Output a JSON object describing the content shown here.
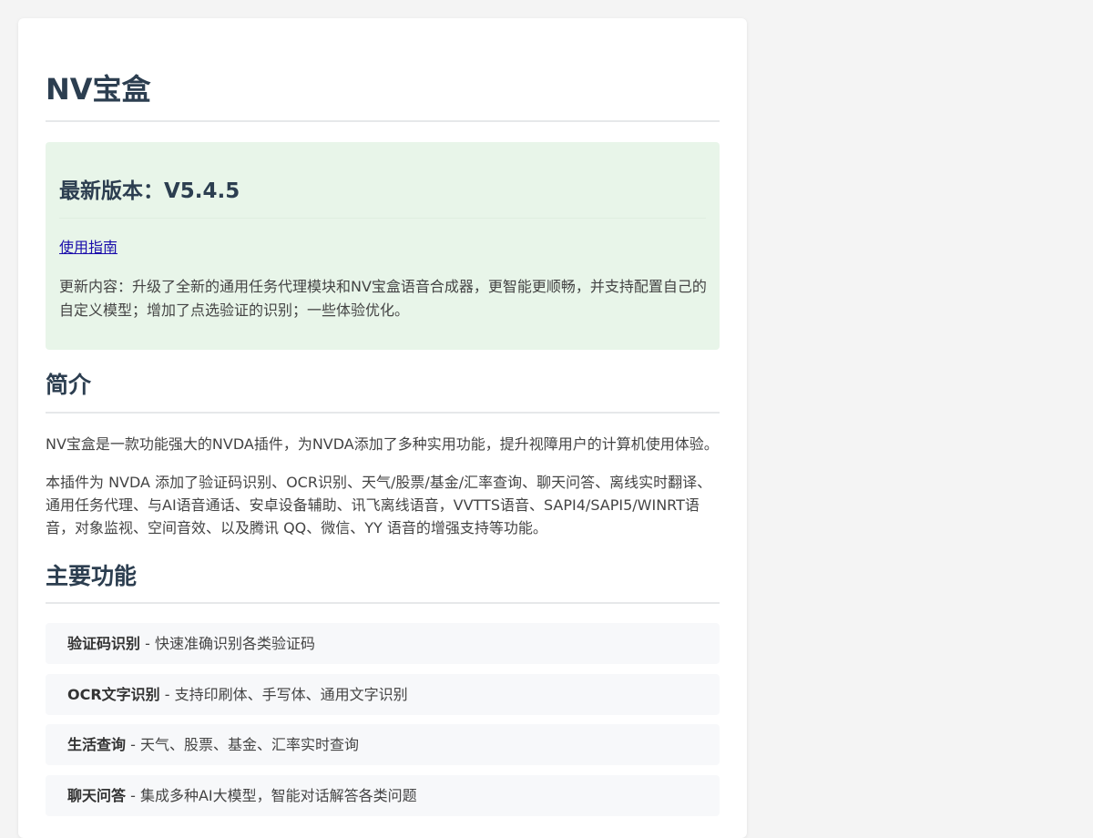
{
  "page_title": "NV宝盒",
  "version": {
    "title": "最新版本：V5.4.5",
    "guide_link": "使用指南",
    "update_notes": "更新内容：升级了全新的通用任务代理模块和NV宝盒语音合成器，更智能更顺畅，并支持配置自己的自定义模型；增加了点选验证的识别；一些体验优化。"
  },
  "intro": {
    "heading": "简介",
    "paragraphs": [
      "NV宝盒是一款功能强大的NVDA插件，为NVDA添加了多种实用功能，提升视障用户的计算机使用体验。",
      "本插件为 NVDA 添加了验证码识别、OCR识别、天气/股票/基金/汇率查询、聊天问答、离线实时翻译、通用任务代理、与AI语音通话、安卓设备辅助、讯飞离线语音，VVTTS语音、SAPI4/SAPI5/WINRT语音，对象监视、空间音效、以及腾讯 QQ、微信、YY 语音的增强支持等功能。"
    ]
  },
  "features": {
    "heading": "主要功能",
    "items": [
      {
        "name": "验证码识别",
        "desc": " - 快速准确识别各类验证码"
      },
      {
        "name": "OCR文字识别",
        "desc": " - 支持印刷体、手写体、通用文字识别"
      },
      {
        "name": "生活查询",
        "desc": " - 天气、股票、基金、汇率实时查询"
      },
      {
        "name": "聊天问答",
        "desc": " - 集成多种AI大模型，智能对话解答各类问题"
      }
    ]
  },
  "colors": {
    "page_background": "#f4f4f4",
    "card_background": "#ffffff",
    "heading": "#2c3e50",
    "version_box": "#e8f5e9",
    "feature_background": "#f7f8fa",
    "link": "#1a0dab"
  }
}
